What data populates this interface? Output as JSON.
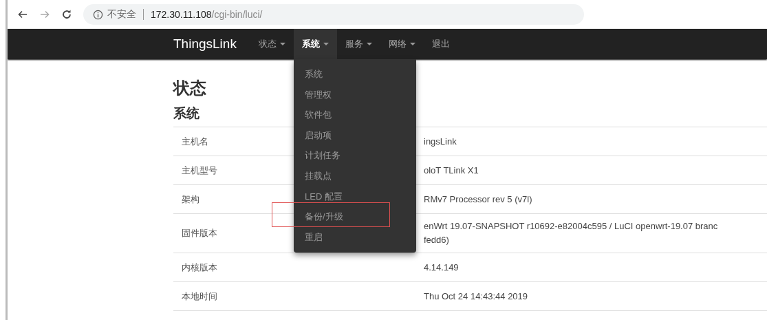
{
  "browser": {
    "security_label": "不安全",
    "url_host": "172.30.11.108",
    "url_path": "/cgi-bin/luci/"
  },
  "navbar": {
    "brand": "ThingsLink",
    "items": [
      {
        "label": "状态",
        "dropdown": true,
        "selected": false
      },
      {
        "label": "系统",
        "dropdown": true,
        "selected": true
      },
      {
        "label": "服务",
        "dropdown": true,
        "selected": false
      },
      {
        "label": "网络",
        "dropdown": true,
        "selected": false
      },
      {
        "label": "退出",
        "dropdown": false,
        "selected": false
      }
    ]
  },
  "dropdown_menu": {
    "items": [
      {
        "label": "系统",
        "highlighted": false
      },
      {
        "label": "管理权",
        "highlighted": false
      },
      {
        "label": "软件包",
        "highlighted": false
      },
      {
        "label": "启动项",
        "highlighted": false
      },
      {
        "label": "计划任务",
        "highlighted": false
      },
      {
        "label": "挂载点",
        "highlighted": false
      },
      {
        "label": "LED 配置",
        "highlighted": false
      },
      {
        "label": "备份/升级",
        "highlighted": true
      },
      {
        "label": "重启",
        "highlighted": false
      }
    ]
  },
  "page": {
    "title": "状态",
    "section": "系统"
  },
  "table": {
    "rows": [
      {
        "label": "主机名",
        "value": [
          "ingsLink"
        ]
      },
      {
        "label": "主机型号",
        "value": [
          "oloT TLink X1"
        ]
      },
      {
        "label": "架构",
        "value": [
          "RMv7 Processor rev 5 (v7l)"
        ]
      },
      {
        "label": "固件版本",
        "value": [
          "enWrt 19.07-SNAPSHOT r10692-e82004c595 / LuCI openwrt-19.07 branc",
          "fedd6)"
        ]
      },
      {
        "label": "内核版本",
        "value": [
          "4.14.149"
        ]
      },
      {
        "label": "本地时间",
        "value": [
          "Thu Oct 24 14:43:44 2019"
        ]
      }
    ]
  }
}
